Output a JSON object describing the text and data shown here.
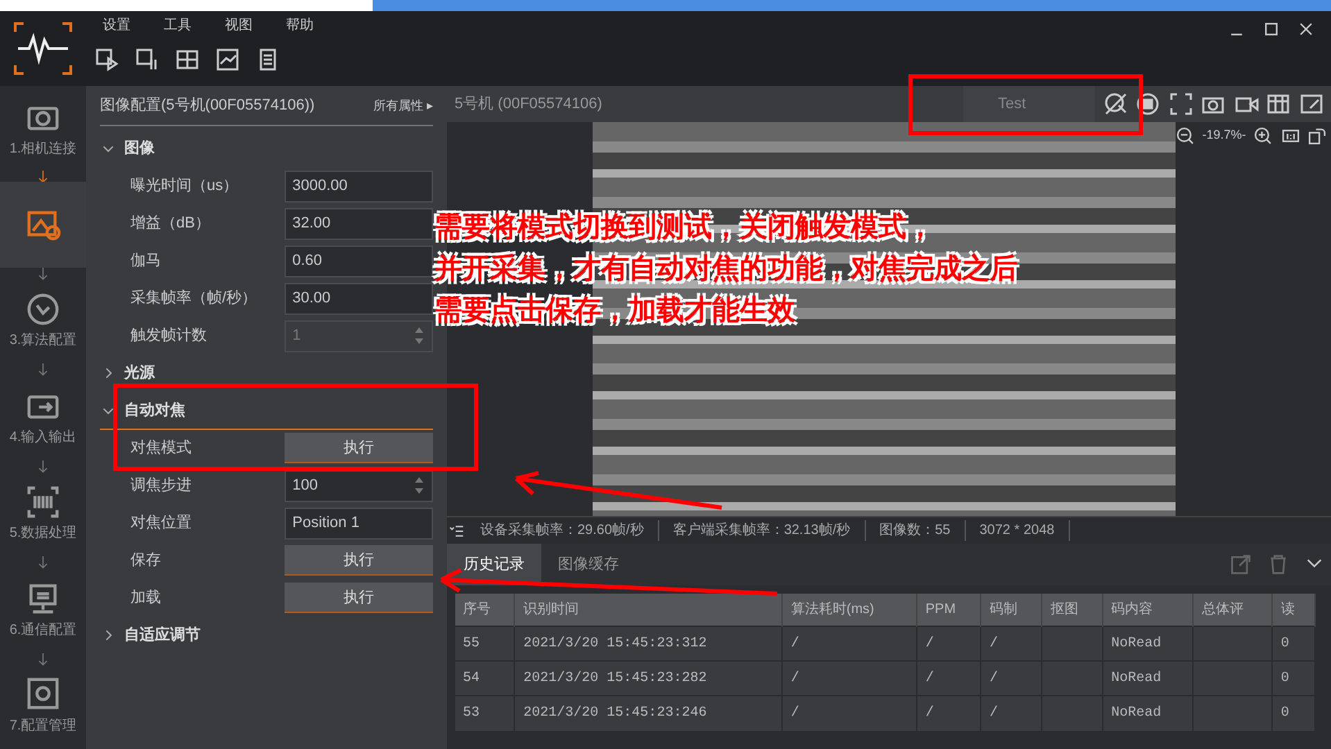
{
  "menu": [
    "设置",
    "工具",
    "视图",
    "帮助"
  ],
  "nav": [
    {
      "label": "1.相机连接",
      "selected": false
    },
    {
      "selected": true
    },
    {
      "label": "3.算法配置",
      "selected": false
    },
    {
      "label": "4.输入输出",
      "selected": false
    },
    {
      "label": "5.数据处理",
      "selected": false
    },
    {
      "label": "6.通信配置",
      "selected": false
    },
    {
      "label": "7.配置管理",
      "selected": false
    }
  ],
  "panel": {
    "title": "图像配置(5号机(00F05574106))",
    "link": "所有属性 ▸",
    "params": [
      {
        "kind": "section",
        "label": "图像",
        "expanded": true,
        "selected": false
      },
      {
        "kind": "input",
        "label": "曝光时间（us）",
        "value": "3000.00"
      },
      {
        "kind": "input",
        "label": "增益（dB）",
        "value": "32.00"
      },
      {
        "kind": "input",
        "label": "伽马",
        "value": "0.60"
      },
      {
        "kind": "input",
        "label": "采集帧率（帧/秒）",
        "value": "30.00"
      },
      {
        "kind": "spin",
        "label": "触发帧计数",
        "value": "1",
        "disabled": true
      },
      {
        "kind": "section",
        "label": "光源",
        "expanded": false,
        "selected": false
      },
      {
        "kind": "section",
        "label": "自动对焦",
        "expanded": true,
        "selected": true
      },
      {
        "kind": "button",
        "label": "对焦模式",
        "value": "执行"
      },
      {
        "kind": "spin",
        "label": "调焦步进",
        "value": "100",
        "disabled": false
      },
      {
        "kind": "select",
        "label": "对焦位置",
        "value": "Position 1"
      },
      {
        "kind": "button",
        "label": "保存",
        "value": "执行"
      },
      {
        "kind": "button",
        "label": "加载",
        "value": "执行"
      },
      {
        "kind": "section",
        "label": "自适应调节",
        "expanded": false,
        "selected": false
      }
    ]
  },
  "viewer": {
    "camera": "5号机 (00F05574106)",
    "mode": "Test",
    "zoom": "-19.7%-"
  },
  "annotation": [
    "需要将模式切换到测试，关闭触发模式，",
    "并开采集，才有自动对焦的功能，对焦完成之后",
    "需要点击保存，加载才能生效"
  ],
  "status": [
    "设备采集帧率：29.60帧/秒",
    "客户端采集帧率：32.13帧/秒",
    "图像数：55",
    "3072 * 2048"
  ],
  "tabs": [
    {
      "label": "历史记录",
      "selected": true
    },
    {
      "label": "图像缓存",
      "selected": false
    }
  ],
  "table": {
    "columns": [
      "序号",
      "识别时间",
      "算法耗时(ms)",
      "PPM",
      "码制",
      "抠图",
      "码内容",
      "总体评",
      "读"
    ],
    "rows": [
      [
        "55",
        "2021/3/20 15:45:23:312",
        "/",
        "/",
        "/",
        "",
        "NoRead",
        "",
        "0"
      ],
      [
        "54",
        "2021/3/20 15:45:23:282",
        "/",
        "/",
        "/",
        "",
        "NoRead",
        "",
        "0"
      ],
      [
        "53",
        "2021/3/20 15:45:23:246",
        "/",
        "/",
        "/",
        "",
        "NoRead",
        "",
        "0"
      ]
    ]
  }
}
